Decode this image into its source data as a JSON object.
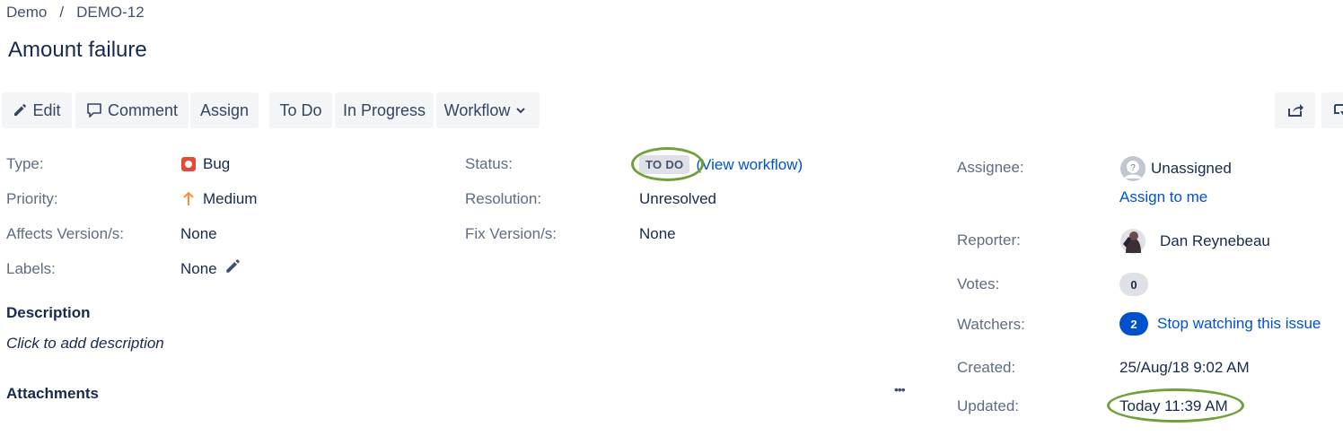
{
  "breadcrumb": {
    "project": "Demo",
    "separator": "/",
    "issue_key": "DEMO-12"
  },
  "issue": {
    "title": "Amount failure"
  },
  "toolbar": {
    "edit": "Edit",
    "comment": "Comment",
    "assign": "Assign",
    "todo": "To Do",
    "in_progress": "In Progress",
    "workflow": "Workflow"
  },
  "details": {
    "type": {
      "label": "Type:",
      "value": "Bug"
    },
    "priority": {
      "label": "Priority:",
      "value": "Medium"
    },
    "affects": {
      "label": "Affects Version/s:",
      "value": "None"
    },
    "labels": {
      "label": "Labels:",
      "value": "None"
    },
    "status": {
      "label": "Status:",
      "value": "TO DO",
      "link": "(View workflow)"
    },
    "resolution": {
      "label": "Resolution:",
      "value": "Unresolved"
    },
    "fix": {
      "label": "Fix Version/s:",
      "value": "None"
    }
  },
  "people": {
    "assignee": {
      "label": "Assignee:",
      "value": "Unassigned",
      "action": "Assign to me"
    },
    "reporter": {
      "label": "Reporter:",
      "value": "Dan Reynebeau"
    },
    "votes": {
      "label": "Votes:",
      "count": "0"
    },
    "watchers": {
      "label": "Watchers:",
      "count": "2",
      "action": "Stop watching this issue"
    }
  },
  "dates": {
    "created": {
      "label": "Created:",
      "value": "25/Aug/18 9:02 AM"
    },
    "updated": {
      "label": "Updated:",
      "value": "Today 11:39 AM"
    }
  },
  "description": {
    "heading": "Description",
    "placeholder": "Click to add description"
  },
  "attachments": {
    "heading": "Attachments",
    "more": "•••"
  },
  "colors": {
    "link": "#0052cc",
    "bug": "#e5493a",
    "priority_medium": "#f79232",
    "highlight_ring": "#6fa03a",
    "watch_badge": "#0052cc"
  }
}
